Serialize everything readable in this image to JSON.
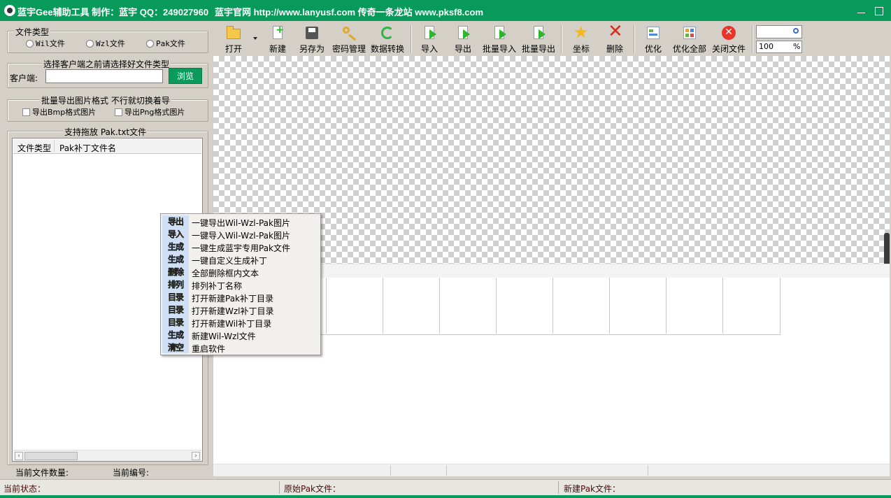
{
  "window": {
    "title_left": "蓝宇Gee辅助工具  制作：蓝宇 QQ：249027960",
    "title_right": "蓝宇官网 http://www.lanyusf.com  传奇一条龙站 www.pksf8.com"
  },
  "file_type_group": {
    "title": "文件类型",
    "options": [
      "Wil文件",
      "Wzl文件",
      "Pak文件"
    ]
  },
  "client_group": {
    "title": "选择客户端之前请选择好文件类型",
    "label": "客户端:",
    "value": "",
    "browse": "浏览"
  },
  "batch_export_group": {
    "title": "批量导出图片格式  不行就切换着导",
    "options": [
      "导出Bmp格式图片",
      "导出Png格式图片"
    ]
  },
  "drag_group": {
    "title": "支持拖放 Pak.txt文件",
    "columns": [
      "文件类型",
      "Pak补丁文件名"
    ]
  },
  "left_status": {
    "count_label": "当前文件数量:",
    "index_label": "当前编号:"
  },
  "toolbar": {
    "buttons": [
      "打开",
      "新建",
      "另存为",
      "密码管理",
      "数据转换",
      "导入",
      "导出",
      "批量导入",
      "批量导出",
      "坐标",
      "删除",
      "优化",
      "优化全部",
      "关闭文件"
    ],
    "zoom_value": "100",
    "zoom_unit": "%"
  },
  "context_menu": {
    "items": [
      {
        "badge": "导出",
        "label": "一键导出Wil-Wzl-Pak图片",
        "color": "#f2e81a"
      },
      {
        "badge": "导入",
        "label": "一键导入Wil-Wzl-Pak图片",
        "color": "#f07a1a"
      },
      {
        "badge": "生成",
        "label": "一键生成蓝宇专用Pak文件",
        "color": "#2a7ae8"
      },
      {
        "badge": "生成",
        "label": "一键自定义生成补丁",
        "color": "#2a7ae8"
      },
      {
        "badge": "删除",
        "label": "全部删除框内文本",
        "color": "#e8e21a"
      },
      {
        "badge": "排列",
        "label": "排列补丁名称",
        "color": "#42d62a"
      },
      {
        "badge": "目录",
        "label": "打开新建Pak补丁目录",
        "color": "#e8e21a"
      },
      {
        "badge": "目录",
        "label": "打开新建Wzl补丁目录",
        "color": "#e8e21a"
      },
      {
        "badge": "目录",
        "label": "打开新建Wil补丁目录",
        "color": "#e8e21a"
      },
      {
        "badge": "生成",
        "label": "新建Wil-Wzl文件",
        "color": "#2a7ae8"
      },
      {
        "badge": "清空",
        "label": "重启软件",
        "color": "#f2e81a"
      }
    ]
  },
  "statusbar": {
    "state": "当前状态：",
    "original": "原始Pak文件：",
    "new": "新建Pak文件："
  },
  "colors": {
    "titlebar": "#079a5a",
    "accent_button": "#0a9a5c"
  }
}
